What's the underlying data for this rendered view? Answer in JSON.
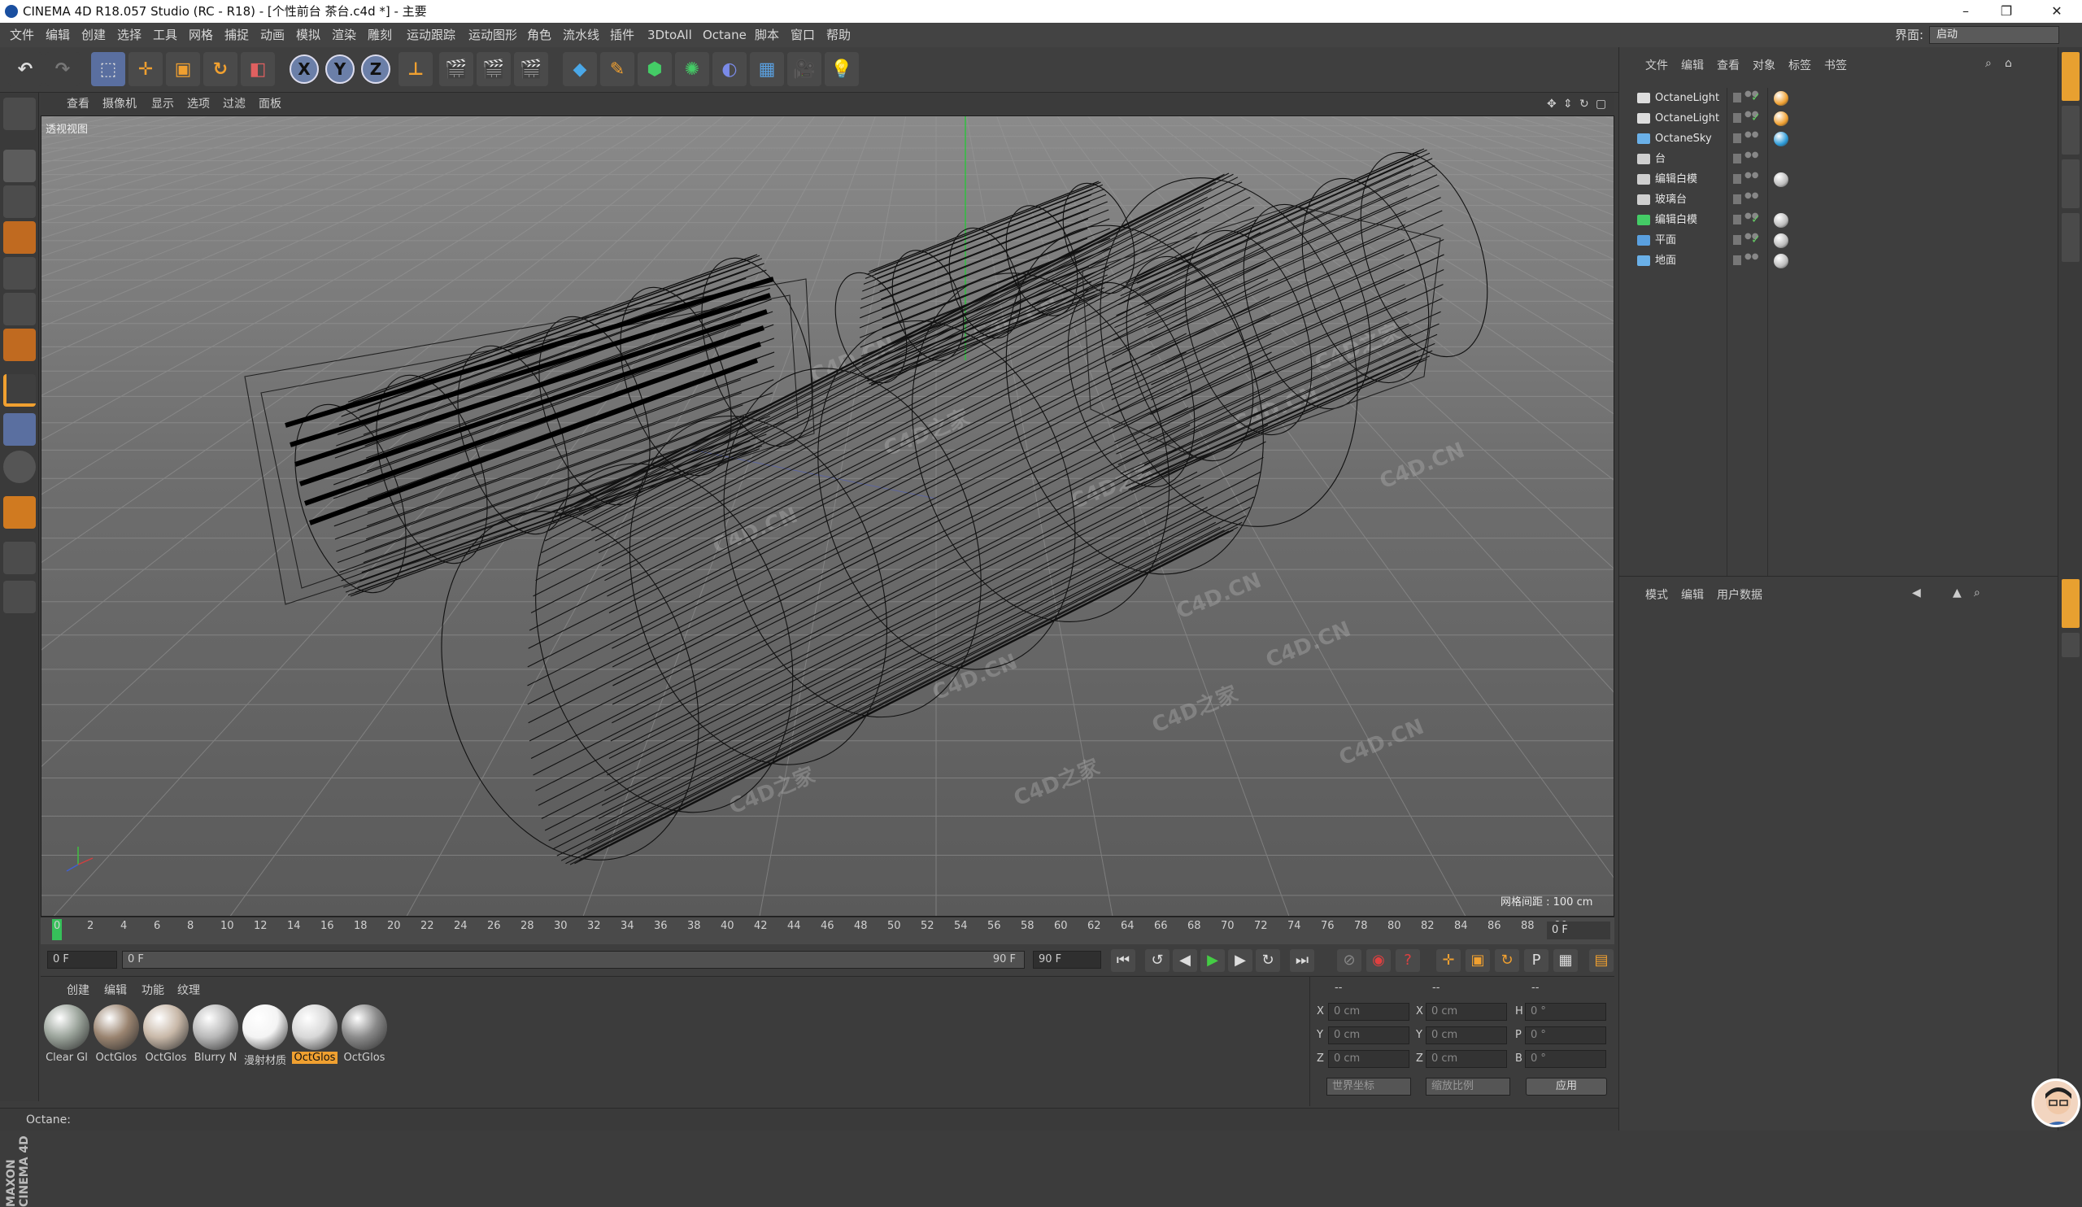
{
  "window": {
    "title": "CINEMA 4D R18.057 Studio (RC - R18) - [个性前台 茶台.c4d *] - 主要",
    "minimize": "–",
    "maximize": "❐",
    "close": "✕"
  },
  "menu": {
    "items": [
      "文件",
      "编辑",
      "创建",
      "选择",
      "工具",
      "网格",
      "捕捉",
      "动画",
      "模拟",
      "渲染",
      "雕刻",
      "运动跟踪",
      "运动图形",
      "角色",
      "流水线",
      "插件",
      "3DtoAll",
      "Octane",
      "脚本",
      "窗口",
      "帮助"
    ],
    "layout_label": "界面:",
    "layout_value": "启动"
  },
  "toolbar": {
    "axis_x": "X",
    "axis_y": "Y",
    "axis_z": "Z"
  },
  "viewport": {
    "menu": [
      "查看",
      "摄像机",
      "显示",
      "选项",
      "过滤",
      "面板"
    ],
    "label": "透视视图",
    "grid_info": "网格间距 : 100 cm",
    "watermarks": [
      "C4D.CN",
      "C4D之家",
      "C4D.CN",
      "C4D之家",
      "C4D.CN",
      "C4D.CN",
      "C4D之家",
      "C4D.CN",
      "C4D之家",
      "C4D.CN",
      "C4D之家",
      "C4D.CN",
      "C4D.CN",
      "C4D之家",
      "C4D.CN"
    ]
  },
  "timeline": {
    "ticks": [
      "0",
      "2",
      "4",
      "6",
      "8",
      "10",
      "12",
      "14",
      "16",
      "18",
      "20",
      "22",
      "24",
      "26",
      "28",
      "30",
      "32",
      "34",
      "36",
      "38",
      "40",
      "42",
      "44",
      "46",
      "48",
      "50",
      "52",
      "54",
      "56",
      "58",
      "60",
      "62",
      "64",
      "66",
      "68",
      "70",
      "72",
      "74",
      "76",
      "78",
      "80",
      "82",
      "84",
      "86",
      "88",
      "90"
    ],
    "current_frame": "0 F",
    "start_frame": "0 F",
    "range_start": "0 F",
    "range_end": "90 F",
    "end_frame": "90 F"
  },
  "materials": {
    "menu": [
      "创建",
      "编辑",
      "功能",
      "纹理"
    ],
    "items": [
      {
        "label": "Clear Gl",
        "selected": false,
        "color": "#9aa39a"
      },
      {
        "label": "OctGlos",
        "selected": false,
        "color": "#9a8470"
      },
      {
        "label": "OctGlos",
        "selected": false,
        "color": "#c8b8a8"
      },
      {
        "label": "Blurry N",
        "selected": false,
        "color": "#b8b8b8"
      },
      {
        "label": "漫射材质",
        "selected": false,
        "color": "#f4f4f4"
      },
      {
        "label": "OctGlos",
        "selected": true,
        "color": "#d8d8d8"
      },
      {
        "label": "OctGlos",
        "selected": false,
        "color": "#8a8a8a"
      }
    ]
  },
  "coordinates": {
    "headers": [
      "--",
      "--",
      "--"
    ],
    "rows": [
      {
        "a": "X",
        "av": "0 cm",
        "b": "X",
        "bv": "0 cm",
        "c": "H",
        "cv": "0 °"
      },
      {
        "a": "Y",
        "av": "0 cm",
        "b": "Y",
        "bv": "0 cm",
        "c": "P",
        "cv": "0 °"
      },
      {
        "a": "Z",
        "av": "0 cm",
        "b": "Z",
        "bv": "0 cm",
        "c": "B",
        "cv": "0 °"
      }
    ],
    "mode": "世界坐标",
    "scale": "缩放比例",
    "apply": "应用"
  },
  "status": {
    "text": "Octane:"
  },
  "object_manager": {
    "menu": [
      "文件",
      "编辑",
      "查看",
      "对象",
      "标签",
      "书签"
    ],
    "objects": [
      {
        "name": "OctaneLight",
        "icon_color": "#dddddd",
        "tag_color": "#f0a030",
        "check": true
      },
      {
        "name": "OctaneLight",
        "icon_color": "#dddddd",
        "tag_color": "#f0a030",
        "check": true
      },
      {
        "name": "OctaneSky",
        "icon_color": "#6ab0e8",
        "tag_color": "#2a9ad8",
        "check": false
      },
      {
        "name": "台",
        "icon_color": "#cfcfcf",
        "tag_color": "",
        "check": false
      },
      {
        "name": "编辑白模",
        "icon_color": "#cfcfcf",
        "tag_color": "#bbbbbb",
        "check": false
      },
      {
        "name": "玻璃台",
        "icon_color": "#cfcfcf",
        "tag_color": "",
        "check": false
      },
      {
        "name": "编辑白模",
        "icon_color": "#44cc66",
        "tag_color": "#bbbbbb",
        "check": true
      },
      {
        "name": "平面",
        "icon_color": "#5aa0e0",
        "tag_color": "#bbbbbb",
        "check": true
      },
      {
        "name": "地面",
        "icon_color": "#6ab0e8",
        "tag_color": "#bbbbbb",
        "check": false
      }
    ]
  },
  "attribute_manager": {
    "menu": [
      "模式",
      "编辑",
      "用户数据"
    ]
  },
  "branding": {
    "maxon": "MAXON CINEMA 4D"
  }
}
